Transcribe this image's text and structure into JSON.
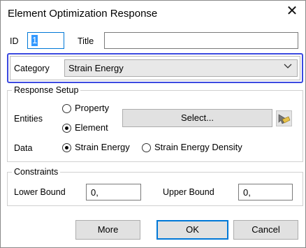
{
  "window": {
    "title": "Element Optimization Response",
    "close_glyph": "✕"
  },
  "id_field": {
    "label": "ID",
    "value": "1"
  },
  "title_field": {
    "label": "Title",
    "value": ""
  },
  "category": {
    "label": "Category",
    "value": "Strain Energy"
  },
  "response_setup": {
    "legend": "Response Setup",
    "entities_label": "Entities",
    "entities_options": [
      "Property",
      "Element"
    ],
    "entities_selected": "Element",
    "select_button": "Select...",
    "picker_icon": "cursor-picker-icon",
    "data_label": "Data",
    "data_options": [
      "Strain Energy",
      "Strain Energy Density"
    ],
    "data_selected": "Strain Energy"
  },
  "constraints": {
    "legend": "Constraints",
    "lower_label": "Lower Bound",
    "lower_value": "0,",
    "upper_label": "Upper Bound",
    "upper_value": "0,"
  },
  "buttons": {
    "more": "More",
    "ok": "OK",
    "cancel": "Cancel"
  },
  "colors": {
    "highlight_frame": "#3c4ae0",
    "focus_blue": "#0078d7",
    "selection": "#3399ff"
  }
}
